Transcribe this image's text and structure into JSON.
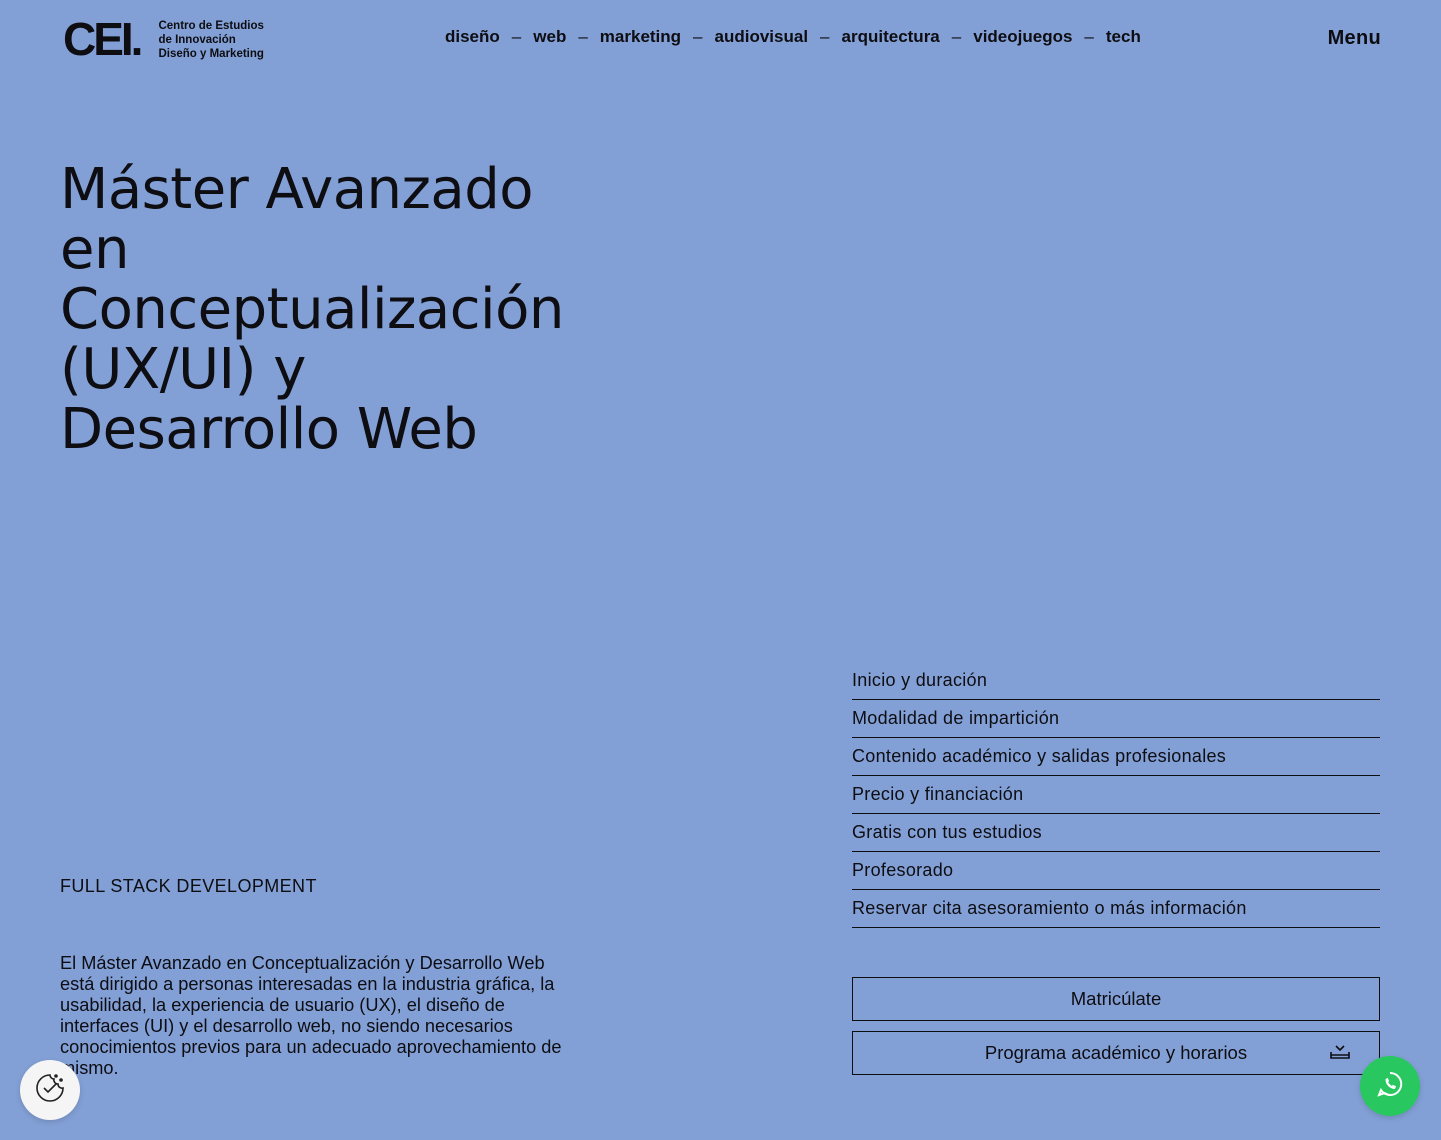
{
  "header": {
    "logo_mark": "CEI.",
    "logo_lines": [
      "Centro de Estudios",
      "de Innovación",
      "Diseño y Marketing"
    ],
    "nav": [
      "diseño",
      "web",
      "marketing",
      "audiovisual",
      "arquitectura",
      "videojuegos",
      "tech"
    ],
    "nav_separator": "–",
    "menu_label": "Menu"
  },
  "hero": {
    "title": "Máster Avanzado en Conceptualización (UX/UI) y Desarrollo Web",
    "subtitle": "FULL STACK DEVELOPMENT",
    "description": "El Máster Avanzado en Conceptualización y Desarrollo Web está dirigido a personas interesadas en la industria gráfica, la usabilidad, la experiencia de usuario (UX), el diseño de interfaces (UI) y el desarrollo web, no siendo necesarios conocimientos previos para un adecuado aprovechamiento de mismo."
  },
  "sections": [
    "Inicio y duración",
    "Modalidad de impartición",
    "Contenido académico y salidas profesionales",
    "Precio y financiación",
    "Gratis con tus estudios",
    "Profesorado",
    "Reservar cita asesoramiento o más información"
  ],
  "actions": {
    "enroll_label": "Matricúlate",
    "program_label": "Programa académico y horarios"
  },
  "icons": {
    "download": "download-icon",
    "cookie": "cookie-consent-icon",
    "whatsapp": "whatsapp-icon"
  },
  "colors": {
    "background": "#83a0d6",
    "text": "#0d0d12",
    "whatsapp": "#28c760"
  }
}
